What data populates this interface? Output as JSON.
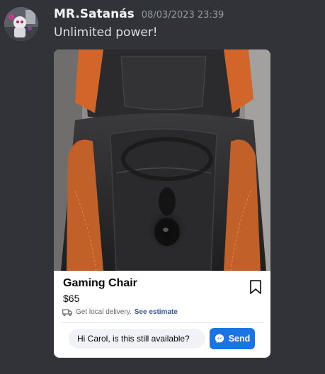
{
  "message": {
    "username": "MR.Satanás",
    "timestamp": "08/03/2023 23:39",
    "text": "Unlimited power!"
  },
  "listing": {
    "image_subject": "dark leather gaming chair seat with orange trim",
    "title": "Gaming Chair",
    "price": "$65",
    "delivery_text": "Get local delivery.",
    "delivery_link": "See estimate",
    "message_input_value": "Hi Carol, is this still available?",
    "send_label": "Send"
  },
  "icons": {
    "avatar": "avatar",
    "bookmark": "bookmark-icon",
    "delivery": "truck-icon",
    "messenger": "messenger-icon"
  },
  "colors": {
    "background": "#313338",
    "username": "#f2f3f5",
    "timestamp": "#949ba4",
    "message_text": "#dbdee1",
    "card": "#ffffff",
    "link": "#385898",
    "send_button": "#1b74e4"
  }
}
